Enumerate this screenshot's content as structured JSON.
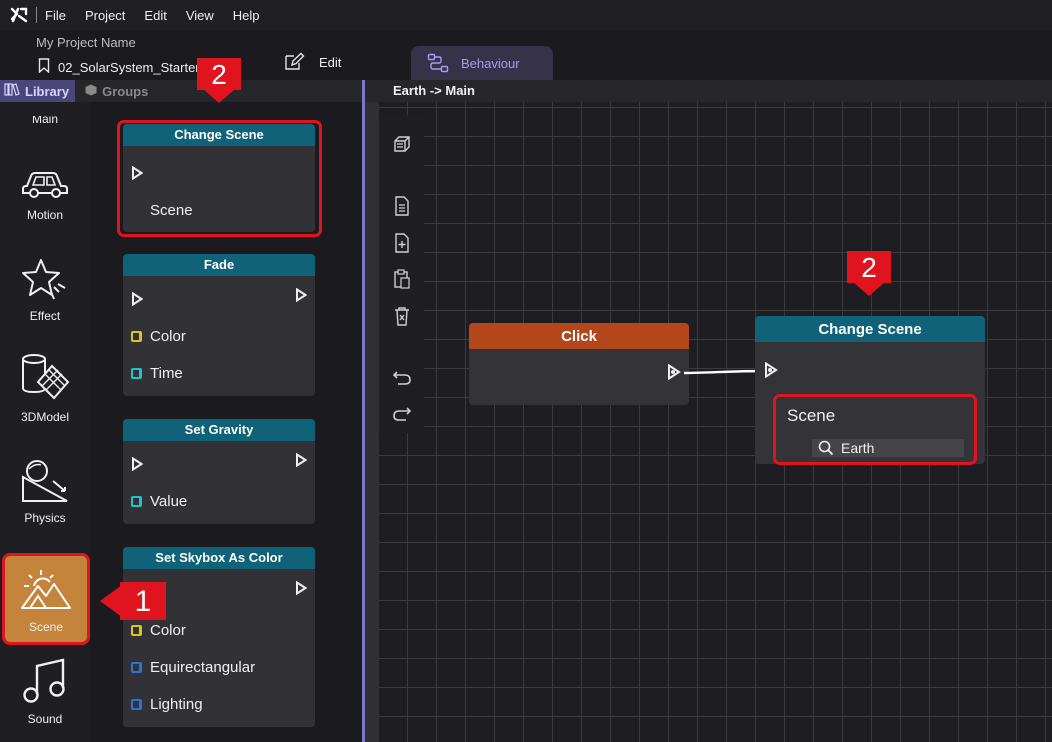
{
  "menubar": {
    "items": [
      "File",
      "Project",
      "Edit",
      "View",
      "Help"
    ]
  },
  "project": {
    "name": "My Project Name",
    "file": "02_SolarSystem_Starter",
    "edit_label": "Edit",
    "tab_label": "Behaviour"
  },
  "library_tabs": {
    "library": "Library",
    "groups": "Groups"
  },
  "categories": {
    "partial": "Main",
    "motion": "Motion",
    "effect": "Effect",
    "model": "3DModel",
    "physics": "Physics",
    "scene": "Scene",
    "sound": "Sound"
  },
  "library_nodes": {
    "change_scene": {
      "title": "Change Scene",
      "input": "Scene"
    },
    "fade": {
      "title": "Fade",
      "inputs": [
        "Color",
        "Time"
      ]
    },
    "set_gravity": {
      "title": "Set Gravity",
      "input": "Value"
    },
    "set_skybox": {
      "title": "Set Skybox As Color",
      "inputs": [
        "Color",
        "Equirectangular",
        "Lighting"
      ]
    }
  },
  "breadcrumb": "Earth -> Main",
  "graph": {
    "click_node": {
      "title": "Click"
    },
    "change_scene_node": {
      "title": "Change Scene",
      "field_label": "Scene",
      "field_value": "Earth"
    }
  },
  "callouts": {
    "one": "1",
    "two_left": "2",
    "two_right": "2"
  },
  "colors": {
    "accent": "#7f76c8",
    "header_teal": "#0f6278",
    "click_orange": "#b3461b",
    "highlight_red": "#e0141e",
    "scene_selected": "#c4843c",
    "pin_yellow": "#d8c81c",
    "pin_cyan": "#20c4c8",
    "pin_blue": "#2a74d8"
  }
}
